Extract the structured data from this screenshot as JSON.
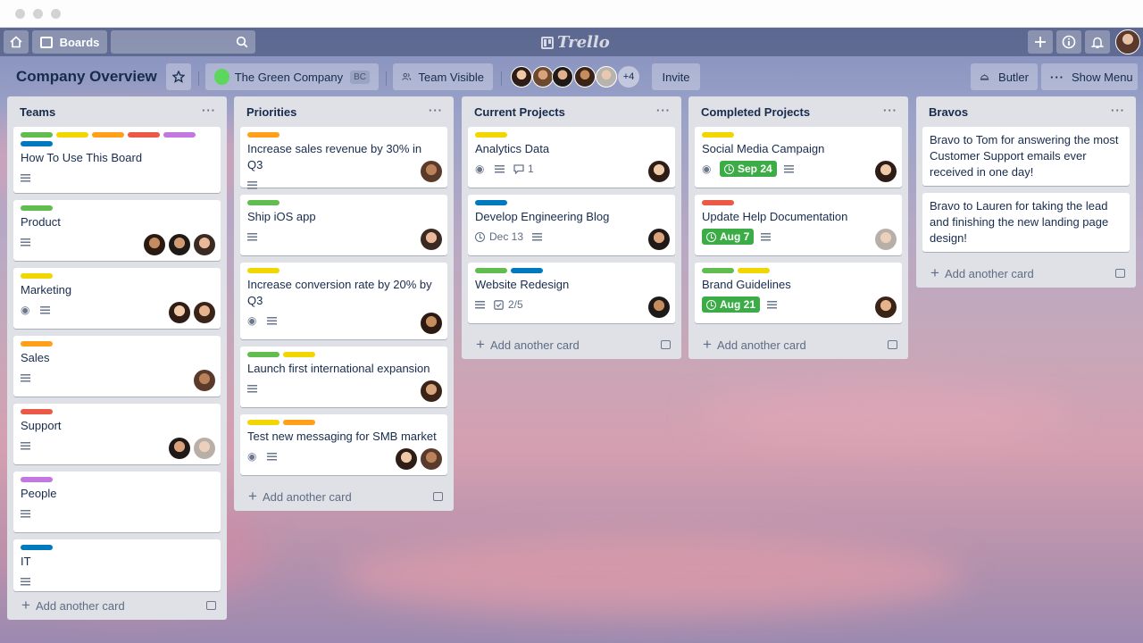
{
  "topbar": {
    "boards_label": "Boards",
    "logo_text": "Trello"
  },
  "board": {
    "title": "Company Overview",
    "team_name": "The Green Company",
    "team_badge": "BC",
    "visibility": "Team Visible",
    "extra_members": "+4",
    "invite_label": "Invite",
    "butler_label": "Butler",
    "show_menu_label": "Show Menu"
  },
  "colors": {
    "green": "#61bd4f",
    "yellow": "#f2d600",
    "orange": "#ff9f1a",
    "red": "#eb5a46",
    "purple": "#c377e0",
    "blue": "#0079bf",
    "due_green": "#3cad46"
  },
  "add_card_label": "Add another card",
  "lists": [
    {
      "title": "Teams",
      "cards": [
        {
          "title": "How To Use This Board",
          "labels": [
            "green",
            "yellow",
            "orange",
            "red",
            "purple",
            "blue"
          ],
          "avatars": []
        },
        {
          "title": "Product",
          "labels": [
            "green"
          ],
          "avatars": [
            "a1",
            "a2",
            "a3"
          ]
        },
        {
          "title": "Marketing",
          "labels": [
            "yellow"
          ],
          "watch": true,
          "avatars": [
            "a4",
            "a5"
          ]
        },
        {
          "title": "Sales",
          "labels": [
            "orange"
          ],
          "avatars": [
            "a6"
          ]
        },
        {
          "title": "Support",
          "labels": [
            "red"
          ],
          "avatars": [
            "a7",
            "a8"
          ]
        },
        {
          "title": "People",
          "labels": [
            "purple"
          ],
          "avatars": []
        },
        {
          "title": "IT",
          "labels": [
            "blue"
          ],
          "avatars": []
        }
      ]
    },
    {
      "title": "Priorities",
      "cards": [
        {
          "title": "Increase sales revenue by 30% in Q3",
          "labels": [
            "orange"
          ],
          "avatars": [
            "a6"
          ]
        },
        {
          "title": "Ship iOS app",
          "labels": [
            "green"
          ],
          "avatars": [
            "a3"
          ]
        },
        {
          "title": "Increase conversion rate by 20% by Q3",
          "labels": [
            "yellow"
          ],
          "watch": true,
          "avatars": [
            "a9"
          ]
        },
        {
          "title": "Launch first international expansion",
          "labels": [
            "green",
            "yellow"
          ],
          "avatars": [
            "a1"
          ]
        },
        {
          "title": "Test new messaging for SMB market",
          "labels": [
            "yellow",
            "orange"
          ],
          "watch": true,
          "avatars": [
            "a4",
            "a6"
          ]
        }
      ]
    },
    {
      "title": "Current Projects",
      "cards": [
        {
          "title": "Analytics Data",
          "labels": [
            "yellow"
          ],
          "watch": true,
          "comments": "1",
          "avatars": [
            "a5"
          ]
        },
        {
          "title": "Develop Engineering Blog",
          "labels": [
            "blue"
          ],
          "date": "Dec 13",
          "avatars": [
            "a7"
          ]
        },
        {
          "title": "Website Redesign",
          "labels": [
            "green",
            "blue"
          ],
          "checklist": "2/5",
          "avatars": [
            "a2"
          ]
        }
      ]
    },
    {
      "title": "Completed Projects",
      "cards": [
        {
          "title": "Social Media Campaign",
          "labels": [
            "yellow"
          ],
          "watch": true,
          "due": "Sep 24",
          "avatars": [
            "a5"
          ]
        },
        {
          "title": "Update Help Documentation",
          "labels": [
            "red"
          ],
          "due": "Aug 7",
          "avatars": [
            "a8"
          ]
        },
        {
          "title": "Brand Guidelines",
          "labels": [
            "green",
            "yellow"
          ],
          "due": "Aug 21",
          "avatars": [
            "a4"
          ]
        }
      ]
    },
    {
      "title": "Bravos",
      "cards": [
        {
          "title": "Bravo to Tom for answering the most Customer Support emails ever received in one day!"
        },
        {
          "title": "Bravo to Lauren for taking the lead and finishing the new landing page design!"
        }
      ]
    }
  ]
}
